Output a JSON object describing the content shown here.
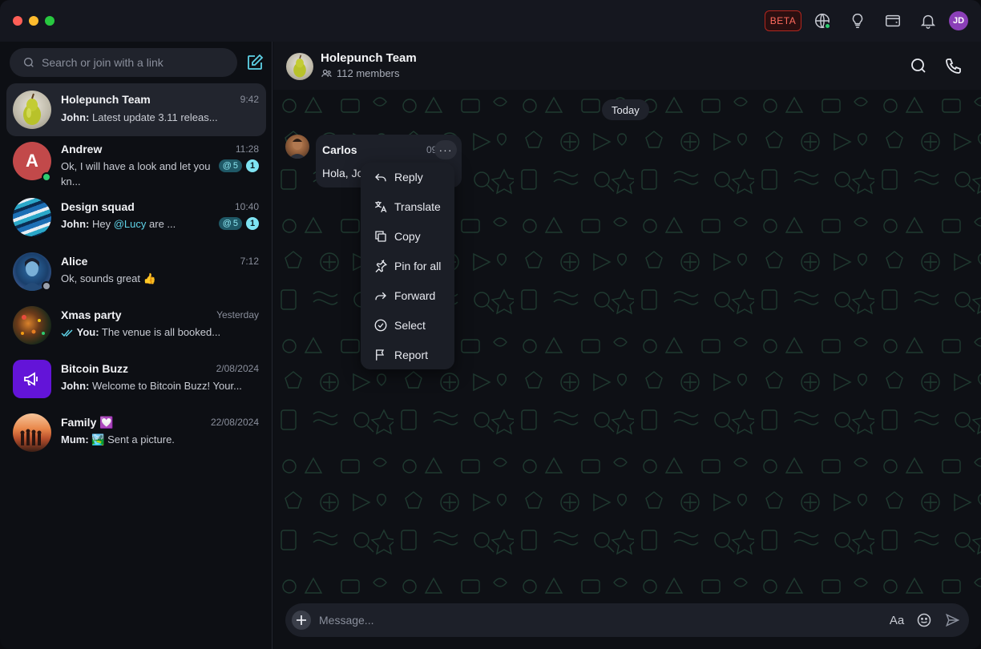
{
  "titlebar": {
    "beta_label": "BETA",
    "avatar_initials": "JD",
    "colors": {
      "close": "#ff5f57",
      "minimize": "#febc2e",
      "maximize": "#28c840"
    }
  },
  "sidebar": {
    "search_placeholder": "Search or join with a link",
    "chats": [
      {
        "name": "Holepunch Team",
        "time": "9:42",
        "sender": "John:",
        "preview": " Latest update 3.11 releas...",
        "active": true
      },
      {
        "name": "Andrew",
        "time": "11:28",
        "sender": "",
        "preview": "Ok, I will have a look and let you kn...",
        "avatar_letter": "A",
        "mentions": "5",
        "unread": "1",
        "status": "online"
      },
      {
        "name": "Design squad",
        "time": "10:40",
        "sender": "John:",
        "preview_pre": " Hey ",
        "mention_text": "@Lucy",
        "preview_post": " are ...",
        "mentions": "5",
        "unread": "1"
      },
      {
        "name": "Alice",
        "time": "7:12",
        "sender": "",
        "preview": "Ok, sounds great 👍",
        "status": "away"
      },
      {
        "name": "Xmas party",
        "time": "Yesterday",
        "sender": "You:",
        "preview": " The venue is all booked..."
      },
      {
        "name": "Bitcoin Buzz",
        "time": "2/08/2024",
        "sender": "John:",
        "preview": " Welcome to Bitcoin Buzz! Your..."
      },
      {
        "name": "Family 💟",
        "time": "22/08/2024",
        "sender": "Mum:",
        "preview": " 🏞️ Sent a picture."
      }
    ]
  },
  "chat": {
    "title": "Holepunch Team",
    "members": "112 members",
    "date_divider": "Today",
    "message": {
      "author": "Carlos",
      "time": "09",
      "text": "Hola, Jo"
    },
    "context_menu": [
      "Reply",
      "Translate",
      "Copy",
      "Pin for all",
      "Forward",
      "Select",
      "Report"
    ],
    "composer_placeholder": "Message...",
    "format_label": "Aa"
  }
}
